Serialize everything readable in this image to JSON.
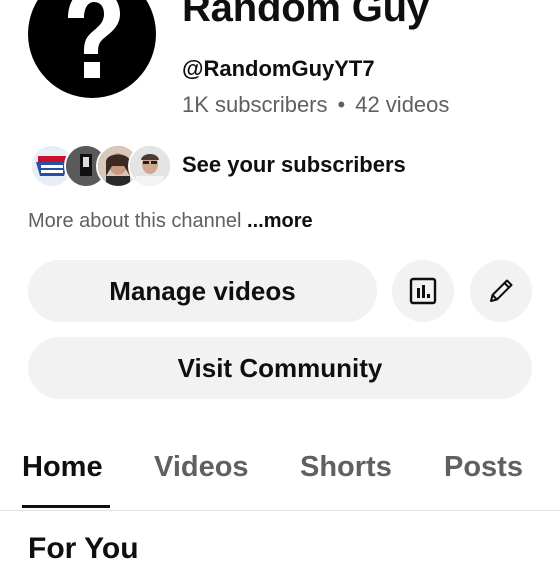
{
  "channel": {
    "name": "Random Guy",
    "handle": "@RandomGuyYT7",
    "subscribers": "1K subscribers",
    "separator": "•",
    "videos": "42 videos",
    "avatar_symbol": "?",
    "subscriber_avatar_icons": [
      "badge-logo-icon",
      "silhouette-icon",
      "person-photo-icon",
      "person-photo-icon"
    ]
  },
  "subscribers_link": "See your subscribers",
  "about": {
    "text": "More about this channel",
    "more_label": "...more"
  },
  "actions": {
    "manage_videos": "Manage videos",
    "analytics_icon": "analytics-icon",
    "edit_icon": "pencil-icon",
    "visit_community": "Visit Community"
  },
  "tabs": [
    {
      "label": "Home",
      "active": true
    },
    {
      "label": "Videos",
      "active": false
    },
    {
      "label": "Shorts",
      "active": false
    },
    {
      "label": "Posts",
      "active": false
    }
  ],
  "section": {
    "title": "For You"
  }
}
